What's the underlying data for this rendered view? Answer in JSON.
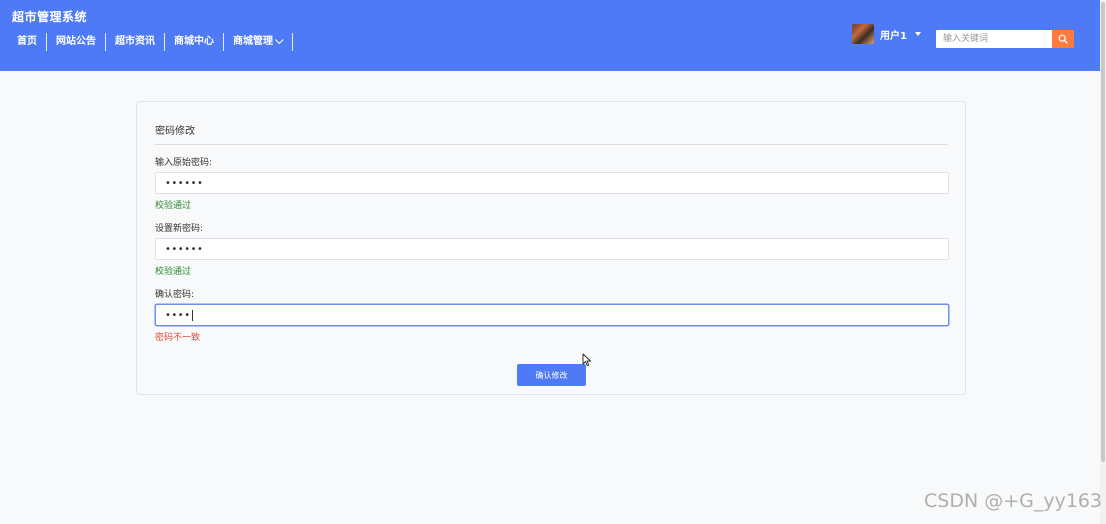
{
  "header": {
    "brand": "超市管理系统",
    "nav": [
      "首页",
      "网站公告",
      "超市资讯",
      "商城中心",
      "商城管理"
    ],
    "user_name": "用户1",
    "search_placeholder": "输入关键词",
    "color": "#4e7bf5"
  },
  "form": {
    "title": "密码修改",
    "fields": [
      {
        "label": "输入原始密码:",
        "value": "••••••",
        "message": "校验通过",
        "status": "ok"
      },
      {
        "label": "设置新密码:",
        "value": "••••••",
        "message": "校验通过",
        "status": "ok"
      },
      {
        "label": "确认密码:",
        "value": "••••",
        "message": "密码不一致",
        "status": "error"
      }
    ],
    "submit_label": "确认修改"
  },
  "watermark": "CSDN @+G_yy163",
  "colors": {
    "primary": "#4e7bf5",
    "search_button": "#ff7a3d",
    "success": "#2e8b2e",
    "error": "#e04a3a"
  }
}
